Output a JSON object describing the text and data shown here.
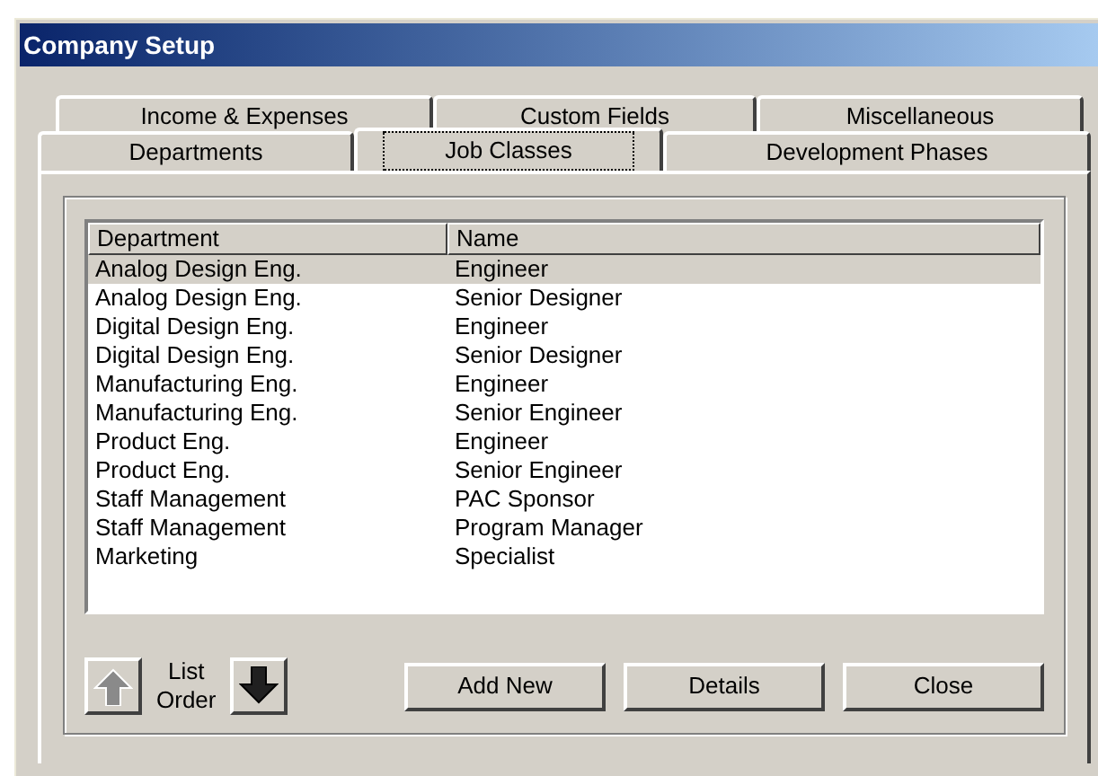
{
  "window": {
    "title": "Company Setup"
  },
  "tab_rows": [
    [
      {
        "label": "Income & Expenses",
        "selected": false
      },
      {
        "label": "Custom Fields",
        "selected": false
      },
      {
        "label": "Miscellaneous",
        "selected": false
      }
    ],
    [
      {
        "label": "Departments",
        "selected": false
      },
      {
        "label": "Job Classes",
        "selected": true
      },
      {
        "label": "Development Phases",
        "selected": false
      }
    ]
  ],
  "table": {
    "columns": [
      "Department",
      "Name"
    ],
    "rows": [
      {
        "cells": [
          "Analog Design Eng.",
          "Engineer"
        ],
        "selected": true
      },
      {
        "cells": [
          "Analog Design Eng.",
          "Senior Designer"
        ],
        "selected": false
      },
      {
        "cells": [
          "Digital Design Eng.",
          "Engineer"
        ],
        "selected": false
      },
      {
        "cells": [
          "Digital Design Eng.",
          "Senior Designer"
        ],
        "selected": false
      },
      {
        "cells": [
          "Manufacturing Eng.",
          "Engineer"
        ],
        "selected": false
      },
      {
        "cells": [
          "Manufacturing Eng.",
          "Senior Engineer"
        ],
        "selected": false
      },
      {
        "cells": [
          "Product Eng.",
          "Engineer"
        ],
        "selected": false
      },
      {
        "cells": [
          "Product Eng.",
          "Senior Engineer"
        ],
        "selected": false
      },
      {
        "cells": [
          "Staff Management",
          "PAC Sponsor"
        ],
        "selected": false
      },
      {
        "cells": [
          "Staff Management",
          "Program Manager"
        ],
        "selected": false
      },
      {
        "cells": [
          "Marketing",
          "Specialist"
        ],
        "selected": false
      }
    ]
  },
  "list_order": {
    "label_lines": [
      "List",
      "Order"
    ],
    "up_disabled": true,
    "down_disabled": false
  },
  "buttons": [
    "Add New",
    "Details",
    "Close"
  ]
}
